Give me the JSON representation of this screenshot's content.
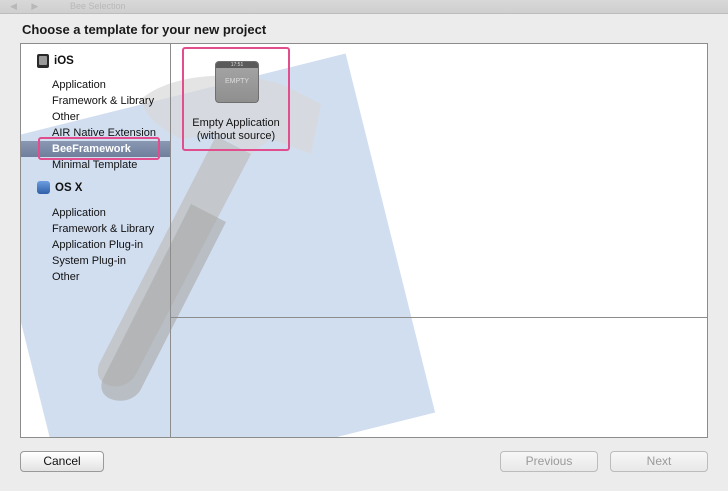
{
  "window": {
    "ghost_title": "Bee Selection",
    "heading": "Choose a template for your new project"
  },
  "sidebar": {
    "sections": [
      {
        "title": "iOS",
        "icon": "iphone-icon",
        "items": [
          "Application",
          "Framework & Library",
          "Other",
          "AIR Native Extension",
          "BeeFramework",
          "Minimal Template"
        ]
      },
      {
        "title": "OS X",
        "icon": "mac-finder-icon",
        "items": [
          "Application",
          "Framework & Library",
          "Application Plug-in",
          "System Plug-in",
          "Other"
        ]
      }
    ],
    "selected": "BeeFramework"
  },
  "templates": [
    {
      "name_line1": "Empty Application",
      "name_line2": "(without source)",
      "thumb_time": "17:51",
      "thumb_label": "EMPTY"
    }
  ],
  "buttons": {
    "cancel": "Cancel",
    "previous": "Previous",
    "next": "Next"
  },
  "colors": {
    "highlight": "#e24d8e",
    "selection": "#7886a4",
    "blueprint": "#7ba0d4"
  }
}
